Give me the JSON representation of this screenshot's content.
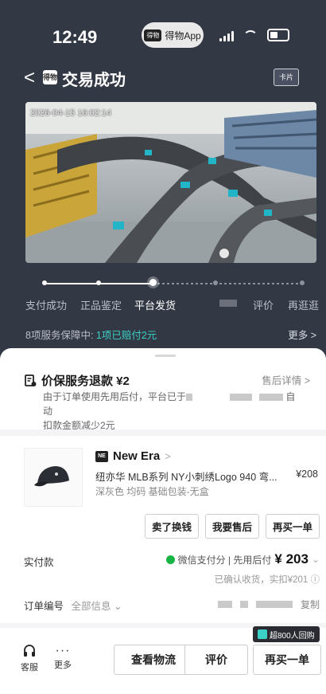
{
  "status_bar": {
    "time": "12:49",
    "app_pill": "得物App",
    "app_pill_logo": "得物"
  },
  "nav": {
    "title": "交易成功",
    "back": "<",
    "logo": "得物",
    "card": "卡片"
  },
  "video": {
    "timestamp": "2026-04-15 16:02:14"
  },
  "steps": [
    {
      "label": "支付成功",
      "active": false
    },
    {
      "label": "正品鉴定",
      "active": false
    },
    {
      "label": "平台发货",
      "active": true
    },
    {
      "label": "",
      "active": false
    },
    {
      "label": "评价",
      "active": false
    },
    {
      "label": "再逛逛",
      "active": false
    }
  ],
  "service": {
    "prefix": "8项服务保障中: ",
    "highlight": "1项已赔付2元",
    "more": "更多 >"
  },
  "price_protect": {
    "title": "价保服务退款 ¥2",
    "link": "售后详情 >",
    "line1": "由于订单使用先用后付，平台已于",
    "line1_end": "自动",
    "line2": "扣款金额减少2元"
  },
  "product": {
    "brand": "New Era",
    "brand_chevron": ">",
    "name": "纽亦华 MLB系列 NY小刺绣Logo 940 弯...",
    "price": "¥208",
    "spec": "深灰色 均码 基础包装-无盒"
  },
  "actions": [
    "卖了换钱",
    "我要售后",
    "再买一单"
  ],
  "payment": {
    "label": "实付款",
    "method": "微信支付分 | 先用后付",
    "amount": "¥ 203",
    "confirm": "已确认收货，实扣¥201 ⓘ"
  },
  "order": {
    "label": "订单编号",
    "all_info": "全部信息",
    "copy": "复制"
  },
  "bottom_bar": {
    "service_label": "客服",
    "more_label": "更多",
    "logistics": "查看物流",
    "review": "评价",
    "rebuy": "再买一单",
    "rebuy_badge": "超800人回购"
  },
  "colors": {
    "header_bg": "#333845",
    "accent_teal": "#3bd1c6",
    "wechat_green": "#16b445"
  }
}
